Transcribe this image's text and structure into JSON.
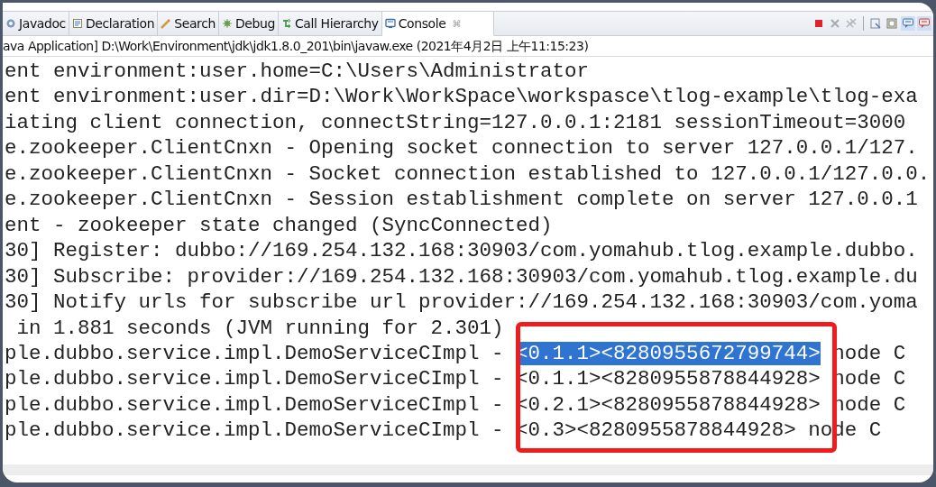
{
  "tabs": [
    {
      "label": "Javadoc",
      "selected": false
    },
    {
      "label": "Declaration",
      "selected": false
    },
    {
      "label": "Search",
      "selected": false
    },
    {
      "label": "Debug",
      "selected": false
    },
    {
      "label": "Call Hierarchy",
      "selected": false
    },
    {
      "label": "Console",
      "selected": true,
      "close": "⌘"
    }
  ],
  "toolbar": [
    {
      "kind": "stop"
    },
    {
      "kind": "remove"
    },
    {
      "kind": "remove-all"
    },
    {
      "kind": "separator"
    },
    {
      "kind": "page"
    },
    {
      "kind": "page2"
    },
    {
      "kind": "chat"
    },
    {
      "kind": "chat-red"
    }
  ],
  "process_label": "ava Application] D:\\Work\\Environment\\jdk\\jdk1.8.0_201\\bin\\javaw.exe (2021年4月2日 上午11:15:23)",
  "console_lines": [
    {
      "text": "ent environment:user.home=C:\\Users\\Administrator"
    },
    {
      "text": "ent environment:user.dir=D:\\Work\\WorkSpace\\workspasce\\tlog-example\\tlog-exa"
    },
    {
      "text": "iating client connection, connectString=127.0.0.1:2181 sessionTimeout=3000"
    },
    {
      "text": "e.zookeeper.ClientCnxn - Opening socket connection to server 127.0.0.1/127."
    },
    {
      "text": "e.zookeeper.ClientCnxn - Socket connection established to 127.0.0.1/127.0.0."
    },
    {
      "text": "e.zookeeper.ClientCnxn - Session establishment complete on server 127.0.0.1"
    },
    {
      "text": "ent - zookeeper state changed (SyncConnected)"
    },
    {
      "text": "30] Register: dubbo://169.254.132.168:30903/com.yomahub.tlog.example.dubbo."
    },
    {
      "text": "30] Subscribe: provider://169.254.132.168:30903/com.yomahub.tlog.example.du"
    },
    {
      "text": "30] Notify urls for subscribe url provider://169.254.132.168:30903/com.yoma"
    },
    {
      "text": " in 1.881 seconds (JVM running for 2.301)"
    },
    {
      "text": "ple.dubbo.service.impl.DemoServiceCImpl - ",
      "selection": "<0.1.1><8280955672799744>",
      "rest": " node C"
    },
    {
      "text": "ple.dubbo.service.impl.DemoServiceCImpl - <0.1.1><8280955878844928> node C"
    },
    {
      "text": "ple.dubbo.service.impl.DemoServiceCImpl - <0.2.1><8280955878844928> node C"
    },
    {
      "text": "ple.dubbo.service.impl.DemoServiceCImpl - <0.3><8280955878844928> node C"
    }
  ]
}
